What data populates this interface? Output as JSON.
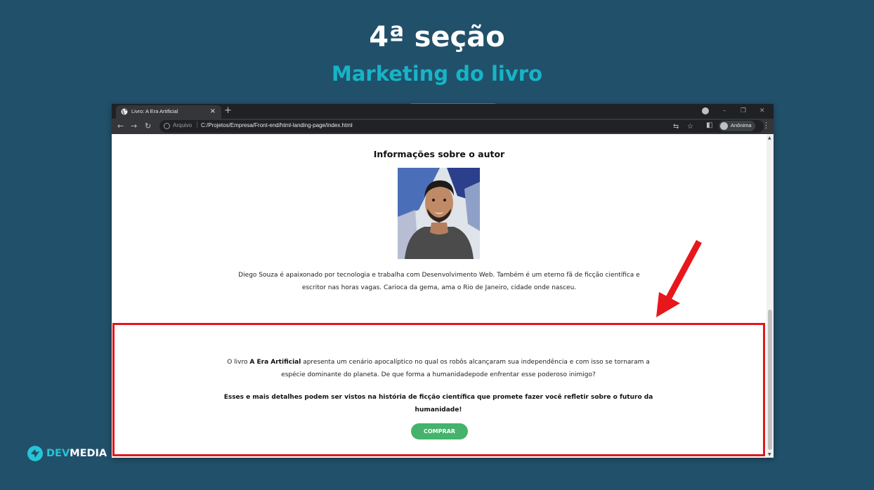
{
  "slide": {
    "title": "4ª seção",
    "subtitle": "Marketing do livro"
  },
  "browser": {
    "tab_title": "Livro: A Era Artificial",
    "tab_close": "×",
    "new_tab": "+",
    "address_prefix": "Arquivo",
    "address_separator": "|",
    "url": "C:/Projetos/Empresa/Front-end/html-landing-page/index.html",
    "profile_label": "Anônima",
    "icons": {
      "back": "back-arrow-icon",
      "forward": "forward-arrow-icon",
      "reload": "reload-icon",
      "translate": "translate-icon",
      "star": "bookmark-star-icon",
      "side_panel": "side-panel-icon",
      "menu": "more-vert-icon"
    }
  },
  "page": {
    "author_heading": "Informações sobre o autor",
    "author_bio": "Diego Souza é apaixonado por tecnologia e trabalha com Desenvolvimento Web. Também é um eterno fã de ficção científica e escritor nas horas vagas. Carioca da gema, ama o Rio de Janeiro, cidade onde nasceu.",
    "marketing": {
      "intro_prefix": "O livro ",
      "book_title": "A Era Artificial",
      "intro_suffix": " apresenta um cenário apocalíptico no qual os robôs alcançaram sua independência e com isso se tornaram a espécie dominante do planeta. De que forma a humanidadepode enfrentar esse poderoso inimigo?",
      "highlight": "Esses e mais detalhes podem ser vistos na história de ficção científica que promete fazer você refletir sobre o futuro da humanidade!",
      "button_label": "COMPRAR"
    }
  },
  "logo": {
    "dev": "DEV",
    "media": "MEDIA"
  },
  "colors": {
    "background": "#21506a",
    "subtitle": "#16b4c6",
    "highlight_border": "#e3161d",
    "button": "#45b36b",
    "arrow": "#e8171c"
  }
}
